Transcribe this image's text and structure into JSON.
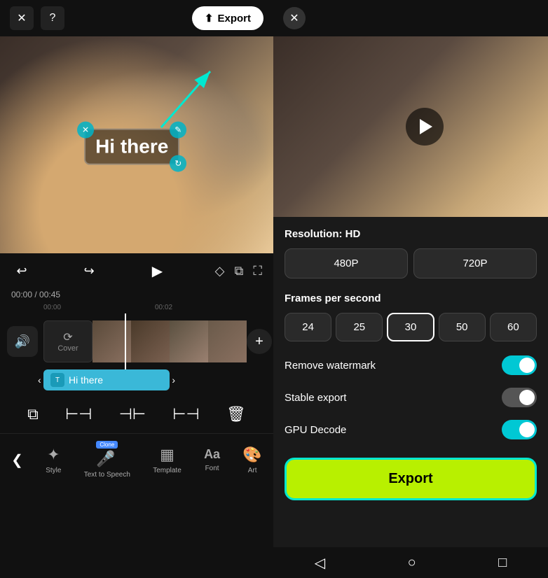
{
  "left_panel": {
    "top_bar": {
      "close_label": "✕",
      "help_label": "?",
      "export_label": "Export",
      "export_icon": "⬆"
    },
    "time_display": {
      "current": "00:00",
      "total": "00:45"
    },
    "time_markers": [
      "00:00",
      "",
      "00:02",
      ""
    ],
    "text_overlay": {
      "text": "Hi there"
    },
    "controls": {
      "undo": "↩",
      "redo": "↪",
      "play": "▶",
      "keyframe": "◇",
      "copy": "⧉",
      "fullscreen": "⛶"
    },
    "audio_btn_icon": "🔊",
    "add_clip_icon": "+",
    "edit_tools": [
      "⧉",
      "⊢⊣",
      "⊣⊢",
      "⊢⊣",
      "🗑"
    ],
    "bottom_nav": [
      {
        "icon": "❮",
        "label": "",
        "name": "collapse"
      },
      {
        "icon": "✦",
        "label": "Style",
        "name": "style"
      },
      {
        "icon": "🎤",
        "label": "Text to Speech",
        "name": "tts",
        "badge": "Clone"
      },
      {
        "icon": "▦",
        "label": "Template",
        "name": "template"
      },
      {
        "icon": "Aa",
        "label": "Font",
        "name": "font"
      },
      {
        "icon": "🎨",
        "label": "Art",
        "name": "art"
      }
    ],
    "hi_there_track": {
      "text": "Hi there",
      "icon": "T"
    }
  },
  "right_panel": {
    "close_icon": "✕",
    "resolution": {
      "title": "Resolution: HD",
      "options": [
        "480P",
        "720P"
      ]
    },
    "fps": {
      "title": "Frames per second",
      "options": [
        "24",
        "25",
        "30",
        "50",
        "60"
      ],
      "active": "30"
    },
    "toggles": [
      {
        "label": "Remove watermark",
        "state": "on",
        "name": "remove-watermark"
      },
      {
        "label": "Stable export",
        "state": "on-dark",
        "name": "stable-export"
      },
      {
        "label": "GPU Decode",
        "state": "on",
        "name": "gpu-decode"
      }
    ],
    "export_btn_label": "Export",
    "android_nav": [
      "◁",
      "○",
      "□"
    ]
  }
}
